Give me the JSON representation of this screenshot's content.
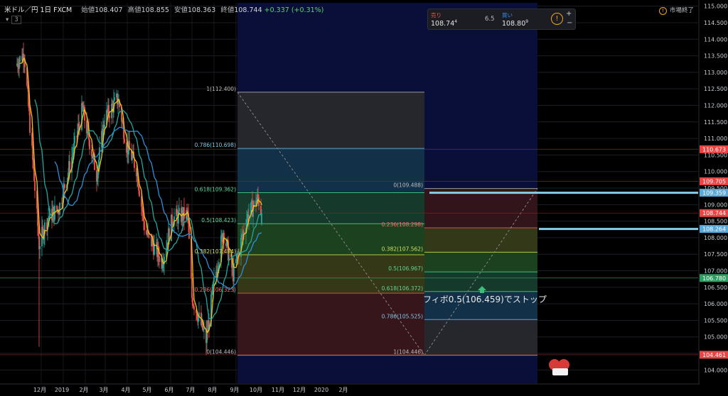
{
  "header": {
    "symbol": "米ドル／円",
    "interval": "1日",
    "broker": "FXCM",
    "open_label": "始値",
    "open": "108.407",
    "high_label": "高値",
    "high": "108.855",
    "low_label": "安値",
    "low": "108.363",
    "close_label": "終値",
    "close": "108.744",
    "change": "+0.337 (+0.31%)",
    "indicator_count": "3"
  },
  "trade_box": {
    "sell_label": "売り",
    "sell_price": "108.74",
    "sell_sup": "4",
    "spread": "6.5",
    "buy_label": "買い",
    "buy_price": "108.80",
    "buy_sup": "9"
  },
  "market_status": "市場終了",
  "annotation": "フィボ0.5(106.459)でストップ",
  "colors": {
    "background": "#000000",
    "up": "#26a69a",
    "down": "#ef5350",
    "ma_short": "#f0c419",
    "ma_mid": "#26a69a",
    "ma_long": "#2f8fd8",
    "price_label": "#e84545",
    "level_line": "#87ceeb"
  },
  "chart_data": {
    "type": "candlestick",
    "y_range": [
      103.6,
      115.1
    ],
    "y_ticks": [
      "115.000",
      "114.500",
      "114.000",
      "113.500",
      "113.000",
      "112.500",
      "112.000",
      "111.500",
      "111.000",
      "110.500",
      "110.000",
      "109.500",
      "109.000",
      "108.500",
      "108.000",
      "107.500",
      "107.000",
      "106.500",
      "106.000",
      "105.500",
      "105.000",
      "104.500",
      "104.000"
    ],
    "x_ticks": [
      "12月",
      "2019",
      "2月",
      "3月",
      "4月",
      "5月",
      "6月",
      "7月",
      "8月",
      "9月",
      "10月",
      "11月",
      "12月",
      "2020",
      "2月"
    ],
    "price_labels": [
      {
        "value": 110.673,
        "text": "110.673",
        "color": "#e84545"
      },
      {
        "value": 109.705,
        "text": "109.705",
        "color": "#e84545"
      },
      {
        "value": 109.359,
        "text": "109.359",
        "color": "#5aa9d8"
      },
      {
        "value": 108.744,
        "text": "108.744",
        "color": "#e84545"
      },
      {
        "value": 108.264,
        "text": "108.264",
        "color": "#5aa9d8"
      },
      {
        "value": 106.78,
        "text": "106.780",
        "color": "#2e9e62"
      },
      {
        "value": 104.461,
        "text": "104.461",
        "color": "#e84545"
      }
    ],
    "fib_left": {
      "levels": [
        {
          "label": "1(112.400)",
          "value": 112.4
        },
        {
          "label": "0.786(110.698)",
          "value": 110.698
        },
        {
          "label": "0.618(109.362)",
          "value": 109.362
        },
        {
          "label": "0.5(108.423)",
          "value": 108.423
        },
        {
          "label": "0.382(107.484)",
          "value": 107.484
        },
        {
          "label": "0.236(106.323)",
          "value": 106.323
        },
        {
          "label": "0(104.446)",
          "value": 104.446
        }
      ]
    },
    "fib_right": {
      "levels": [
        {
          "label": "0(109.488)",
          "value": 109.488
        },
        {
          "label": "0.236(108.298)",
          "value": 108.298
        },
        {
          "label": "0.382(107.562)",
          "value": 107.562
        },
        {
          "label": "0.5(106.967)",
          "value": 106.967
        },
        {
          "label": "0.618(106.372)",
          "value": 106.372
        },
        {
          "label": "0.786(105.525)",
          "value": 105.525
        },
        {
          "label": "1(104.446)",
          "value": 104.446
        }
      ]
    },
    "anchors": [
      {
        "date": "2018-12-01",
        "price": 113.2
      },
      {
        "date": "2018-12-13",
        "price": 113.6
      },
      {
        "date": "2018-12-25",
        "price": 110.3
      },
      {
        "date": "2019-01-03",
        "price": 107.8
      },
      {
        "date": "2019-01-15",
        "price": 108.6
      },
      {
        "date": "2019-01-31",
        "price": 108.9
      },
      {
        "date": "2019-02-20",
        "price": 110.6
      },
      {
        "date": "2019-03-05",
        "price": 111.9
      },
      {
        "date": "2019-03-25",
        "price": 109.9
      },
      {
        "date": "2019-04-05",
        "price": 111.6
      },
      {
        "date": "2019-04-24",
        "price": 112.2
      },
      {
        "date": "2019-05-06",
        "price": 110.8
      },
      {
        "date": "2019-05-20",
        "price": 110.1
      },
      {
        "date": "2019-06-01",
        "price": 108.2
      },
      {
        "date": "2019-06-25",
        "price": 107.3
      },
      {
        "date": "2019-07-10",
        "price": 108.6
      },
      {
        "date": "2019-07-31",
        "price": 108.7
      },
      {
        "date": "2019-08-06",
        "price": 106.2
      },
      {
        "date": "2019-08-26",
        "price": 104.9
      },
      {
        "date": "2019-09-05",
        "price": 106.5
      },
      {
        "date": "2019-09-19",
        "price": 108.2
      },
      {
        "date": "2019-10-03",
        "price": 106.9
      },
      {
        "date": "2019-10-22",
        "price": 108.6
      },
      {
        "date": "2019-11-07",
        "price": 109.2
      },
      {
        "date": "2019-11-12",
        "price": 108.744
      }
    ]
  }
}
